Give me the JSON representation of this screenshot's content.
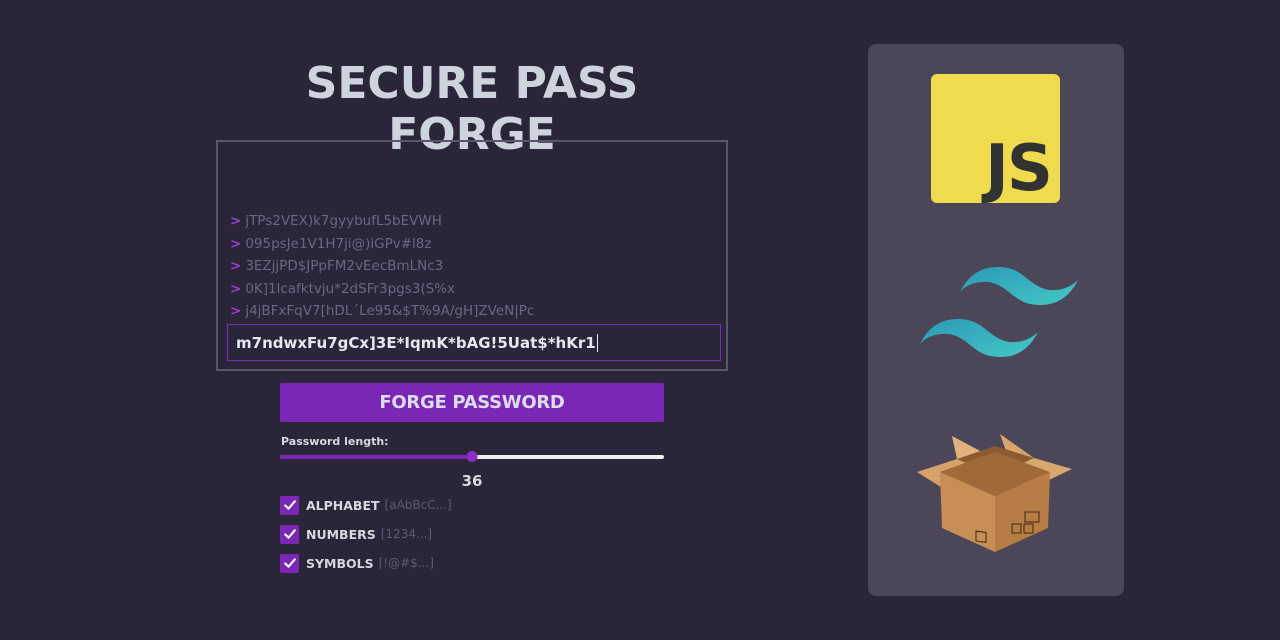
{
  "app": {
    "title": "SECURE PASS FORGE"
  },
  "terminal": {
    "prompt_symbol": ">",
    "history": [
      "jTPs2VEX)k7gyybufL5bEVWH",
      "095psJe1V1H7ji@)iGPv#l8z",
      "3EZjjPD$JPpFM2vEecBmLNc3",
      "0K]1lcafktvju*2dSFr3pgs3(S%x",
      "j4jBFxFqV7[hDL´Le95&$T%9A/gH]ZVeN|Pc"
    ],
    "current_password": "m7ndwxFu7gCx]3E*IqmK*bAG!5Uat$*hKr1"
  },
  "controls": {
    "forge_button_label": "FORGE PASSWORD",
    "length_label": "Password length:",
    "length_value": "36",
    "length_fraction": 0.5
  },
  "options": [
    {
      "label": "ALPHABET",
      "hint": "[aAbBcC...]",
      "checked": true
    },
    {
      "label": "NUMBERS",
      "hint": "[1234...]",
      "checked": true
    },
    {
      "label": "SYMBOLS",
      "hint": "[!@#$...]",
      "checked": true
    }
  ],
  "side_panel": {
    "logos": [
      "javascript-logo",
      "tailwind-logo",
      "package-box-logo"
    ],
    "js_logo_text": "JS"
  },
  "colors": {
    "background": "#2a2539",
    "accent": "#7b27b5",
    "panel": "#4b4759",
    "js_yellow": "#f0db4f",
    "tailwind_teal": "#38bdc8"
  }
}
